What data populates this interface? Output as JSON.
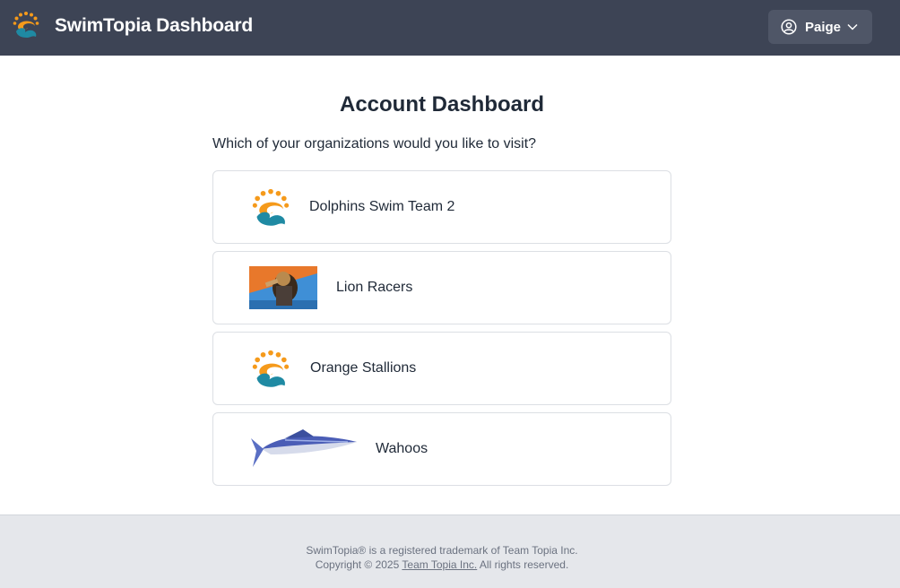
{
  "header": {
    "title": "SwimTopia Dashboard",
    "user_name": "Paige",
    "icons": {
      "logo": "swimtopia-logo",
      "user": "user-circle-icon",
      "menu": "chevron-down-icon"
    },
    "colors": {
      "background": "#3d4455",
      "user_button": "#4f5667"
    }
  },
  "main": {
    "title": "Account Dashboard",
    "prompt": "Which of your organizations would you like to visit?",
    "organizations": [
      {
        "name": "Dolphins Swim Team 2",
        "logo": "swimtopia-logo"
      },
      {
        "name": "Lion Racers",
        "logo": "lion-photo"
      },
      {
        "name": "Orange Stallions",
        "logo": "swimtopia-logo"
      },
      {
        "name": "Wahoos",
        "logo": "wahoo-fish-image"
      }
    ]
  },
  "footer": {
    "trademark": "SwimTopia® is a registered trademark of Team Topia Inc.",
    "copyright_prefix": "Copyright © 2025",
    "company_link": "Team Topia Inc.",
    "copyright_suffix": "All rights reserved."
  }
}
